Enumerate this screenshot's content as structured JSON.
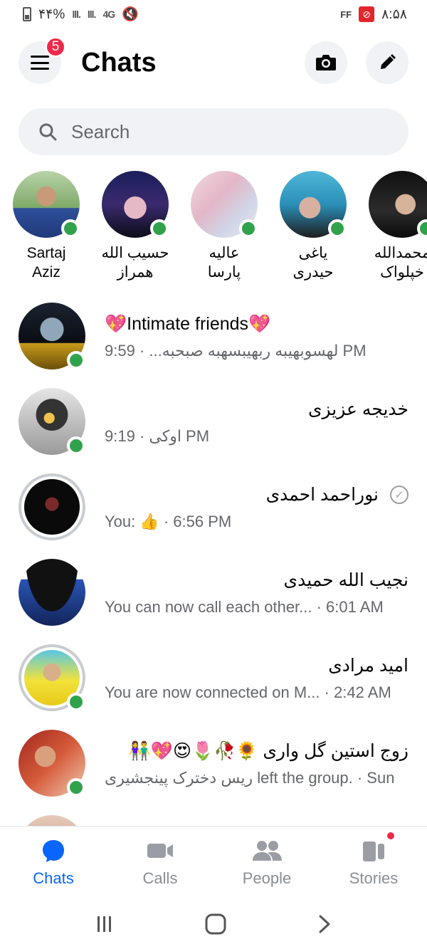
{
  "status_bar": {
    "battery": "۴۴%",
    "network": "4G",
    "left_app_badge": "FF",
    "time": "۸:۵۸"
  },
  "header": {
    "title": "Chats",
    "menu_badge": "5"
  },
  "search": {
    "placeholder": "Search"
  },
  "stories": [
    {
      "line1": "Sartaj",
      "line2": "Aziz",
      "online": true
    },
    {
      "line1": "حسیب الله",
      "line2": "همراز",
      "online": true
    },
    {
      "line1": "عالیه",
      "line2": "پارسا",
      "online": true
    },
    {
      "line1": "یاغی",
      "line2": "حیدری",
      "online": true
    },
    {
      "line1": "محمدالله",
      "line2": "خپلواک",
      "online": true
    }
  ],
  "chats": [
    {
      "name": "💖Intimate friends💖",
      "preview": "لهسوبهیبه ربهیبسهبه صبحبه... · 9:59 PM",
      "online": true
    },
    {
      "name": "خدیجه عزیزی",
      "preview": "اوکی · 9:19 PM",
      "online": true
    },
    {
      "name": "نوراحمد احمدی",
      "preview": "You: 👍 · 6:56 PM",
      "online": false,
      "status_icon": "✓"
    },
    {
      "name": "نجیب الله حمیدی",
      "preview": "You can now call each other... · 6:01 AM",
      "online": false
    },
    {
      "name": "امید مرادی",
      "preview": "You are now connected on M... · 2:42 AM",
      "online": true
    },
    {
      "name": "زوج استین گل واری 🌻🥀🌷😍💖👫",
      "preview": "ریس دخترک پینجشیری left the group. · Sun",
      "online": true
    }
  ],
  "bottom_nav": {
    "tabs": [
      {
        "label": "Chats",
        "icon": "chat-bubble-icon",
        "active": true
      },
      {
        "label": "Calls",
        "icon": "video-camera-icon",
        "active": false
      },
      {
        "label": "People",
        "icon": "people-icon",
        "active": false
      },
      {
        "label": "Stories",
        "icon": "stories-icon",
        "active": false
      }
    ]
  },
  "colors": {
    "accent": "#0866ff",
    "online": "#31a24c",
    "badge": "#f02849",
    "muted_text": "#65676b",
    "input_bg": "#f0f2f5"
  }
}
